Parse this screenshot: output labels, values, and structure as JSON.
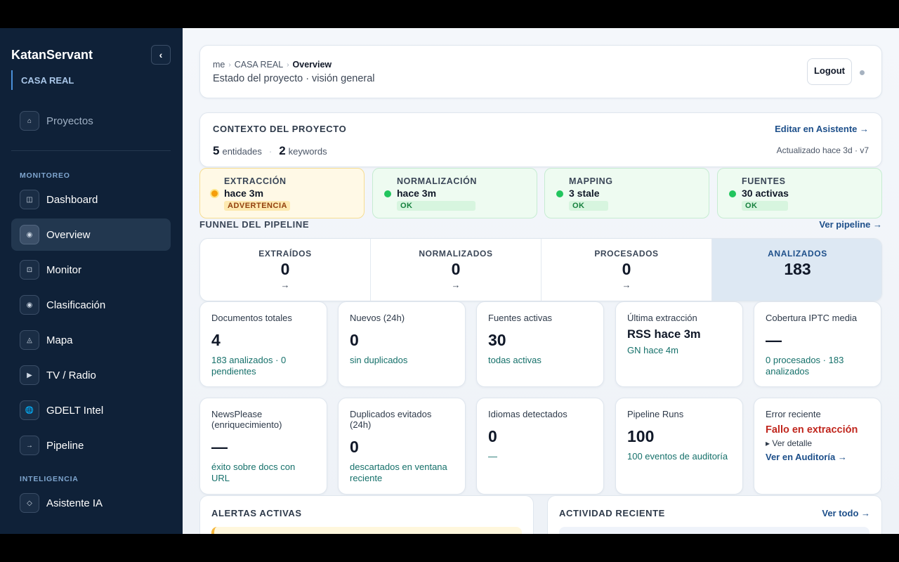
{
  "sidebar": {
    "brand": "KatanServant",
    "collapse_label": "‹",
    "project": "CASA REAL",
    "top_item": {
      "label": "Proyectos",
      "icon": "home-icon",
      "glyph": "⌂"
    },
    "sections": [
      {
        "label": "MONITOREO"
      },
      {
        "label": "INTELIGENCIA"
      }
    ],
    "items": [
      {
        "label": "Dashboard",
        "icon": "dashboard-icon",
        "glyph": "◫"
      },
      {
        "label": "Overview",
        "icon": "overview-icon",
        "glyph": "◉",
        "active": true
      },
      {
        "label": "Monitor",
        "icon": "monitor-icon",
        "glyph": "⊡"
      },
      {
        "label": "Clasificación",
        "icon": "classification-icon",
        "glyph": "◉"
      },
      {
        "label": "Mapa",
        "icon": "map-icon",
        "glyph": "◬"
      },
      {
        "label": "TV / Radio",
        "icon": "play-icon",
        "glyph": "▶"
      },
      {
        "label": "GDELT Intel",
        "icon": "globe-icon",
        "glyph": "🌐"
      },
      {
        "label": "Pipeline",
        "icon": "arrow-right-icon",
        "glyph": "→"
      },
      {
        "label": "Asistente IA",
        "icon": "diamond-icon",
        "glyph": "◇"
      }
    ]
  },
  "header": {
    "breadcrumb": [
      "me",
      "CASA REAL",
      "Overview"
    ],
    "breadcrumb_sep": "›",
    "subtitle": "Estado del proyecto · visión general",
    "logout_label": "Logout"
  },
  "context": {
    "title": "CONTEXTO DEL PROYECTO",
    "edit_link": "Editar en Asistente →",
    "entities_count": "5",
    "entities_label": "entidades",
    "sep": "·",
    "keywords_count": "2",
    "keywords_label": "keywords",
    "updated": "Actualizado hace 3d · v7"
  },
  "status_cards": [
    {
      "label": "EXTRACCIÓN",
      "value": "hace 3m",
      "badge": "ADVERTENCIA",
      "state": "warning"
    },
    {
      "label": "NORMALIZACIÓN",
      "value": "hace 3m",
      "badge": "OK",
      "state": "ok"
    },
    {
      "label": "MAPPING",
      "value": "3 stale",
      "badge": "OK",
      "state": "ok"
    },
    {
      "label": "FUENTES",
      "value": "30 activas",
      "badge": "OK",
      "state": "ok"
    }
  ],
  "funnel": {
    "title": "FUNNEL DEL PIPELINE",
    "link": "Ver pipeline →",
    "steps": [
      {
        "label": "EXTRAÍDOS",
        "value": "0",
        "arrow": "→"
      },
      {
        "label": "NORMALIZADOS",
        "value": "0",
        "arrow": "→"
      },
      {
        "label": "PROCESADOS",
        "value": "0",
        "arrow": "→"
      },
      {
        "label": "ANALIZADOS",
        "value": "183"
      }
    ]
  },
  "metrics_row1": [
    {
      "label": "Documentos totales",
      "value": "4",
      "sub": "183 analizados · 0 pendientes"
    },
    {
      "label": "Nuevos (24h)",
      "value": "0",
      "sub": "sin duplicados"
    },
    {
      "label": "Fuentes activas",
      "value": "30",
      "sub": "todas activas"
    },
    {
      "label": "Última extracción",
      "value": "RSS hace 3m",
      "sub": "GN hace 4m"
    },
    {
      "label": "Cobertura IPTC media",
      "value": "—",
      "sub": "0 procesados · 183 analizados"
    }
  ],
  "metrics_row2": [
    {
      "label": "NewsPlease (enriquecimiento)",
      "value": "—",
      "sub": "éxito sobre docs con URL"
    },
    {
      "label": "Duplicados evitados (24h)",
      "value": "0",
      "sub": "descartados en ventana reciente"
    },
    {
      "label": "Idiomas detectados",
      "value": "0",
      "sub": "—"
    },
    {
      "label": "Pipeline Runs",
      "value": "100",
      "sub": "100 eventos de auditoría"
    },
    {
      "label": "Error reciente",
      "value": "Fallo en extracción",
      "detail": "▸ Ver detalle",
      "link": "Ver en Auditoría →"
    }
  ],
  "alerts": {
    "title": "ALERTAS ACTIVAS"
  },
  "activity": {
    "title": "ACTIVIDAD RECIENTE",
    "link": "Ver todo →"
  },
  "colors": {
    "sidebar_bg": "#0f2138",
    "accent": "#1d4f8a",
    "ok": "#22c55e",
    "warning": "#f59e0b",
    "error": "#c0261d",
    "sub_text": "#15706a"
  }
}
